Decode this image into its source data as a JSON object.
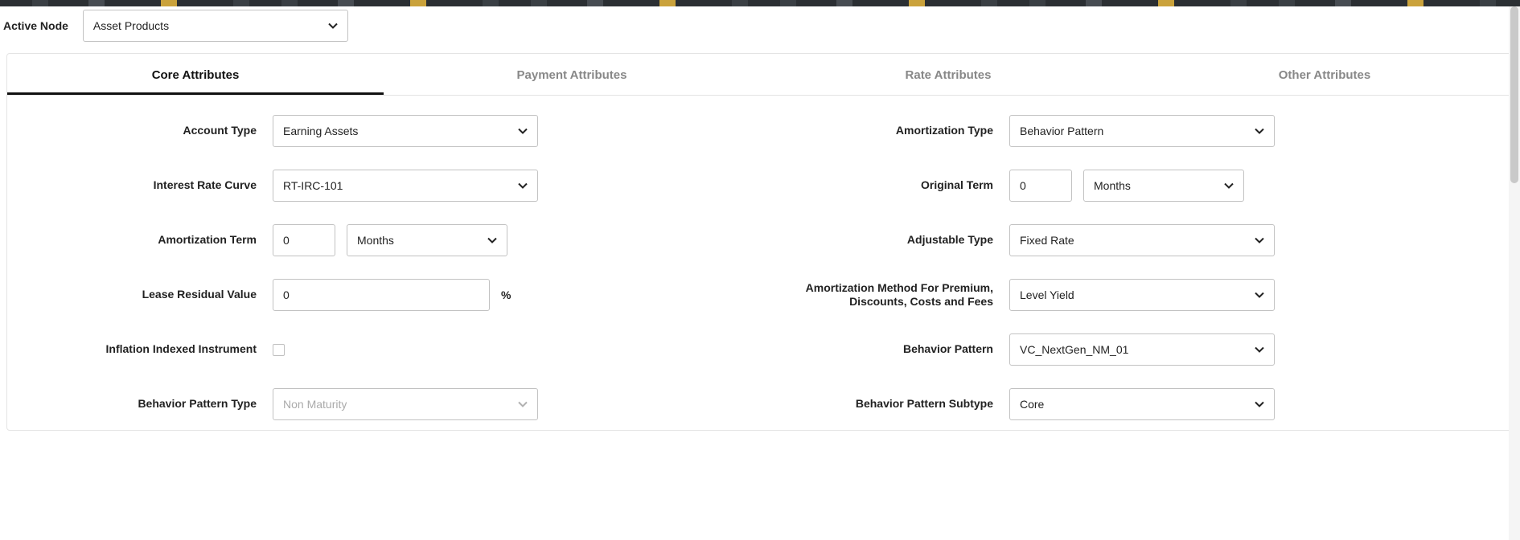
{
  "activeNode": {
    "label": "Active Node",
    "value": "Asset Products"
  },
  "tabs": [
    {
      "label": "Core Attributes",
      "active": true
    },
    {
      "label": "Payment Attributes",
      "active": false
    },
    {
      "label": "Rate Attributes",
      "active": false
    },
    {
      "label": "Other Attributes",
      "active": false
    }
  ],
  "left": {
    "accountType": {
      "label": "Account Type",
      "value": "Earning Assets"
    },
    "interestRateCurve": {
      "label": "Interest Rate Curve",
      "value": "RT-IRC-101"
    },
    "amortizationTerm": {
      "label": "Amortization Term",
      "value": "0",
      "unit": "Months"
    },
    "leaseResidualValue": {
      "label": "Lease Residual Value",
      "value": "0",
      "unit": "%"
    },
    "inflationIndexed": {
      "label": "Inflation Indexed Instrument",
      "checked": false
    },
    "behaviorPatternType": {
      "label": "Behavior Pattern Type",
      "value": "Non Maturity",
      "disabled": true
    }
  },
  "right": {
    "amortizationType": {
      "label": "Amortization Type",
      "value": "Behavior Pattern"
    },
    "originalTerm": {
      "label": "Original Term",
      "value": "0",
      "unit": "Months"
    },
    "adjustableType": {
      "label": "Adjustable Type",
      "value": "Fixed Rate"
    },
    "amortMethodPDCF": {
      "label": "Amortization Method For Premium, Discounts, Costs and Fees",
      "value": "Level Yield"
    },
    "behaviorPattern": {
      "label": "Behavior Pattern",
      "value": "VC_NextGen_NM_01"
    },
    "behaviorPatternSub": {
      "label": "Behavior Pattern Subtype",
      "value": "Core"
    }
  }
}
